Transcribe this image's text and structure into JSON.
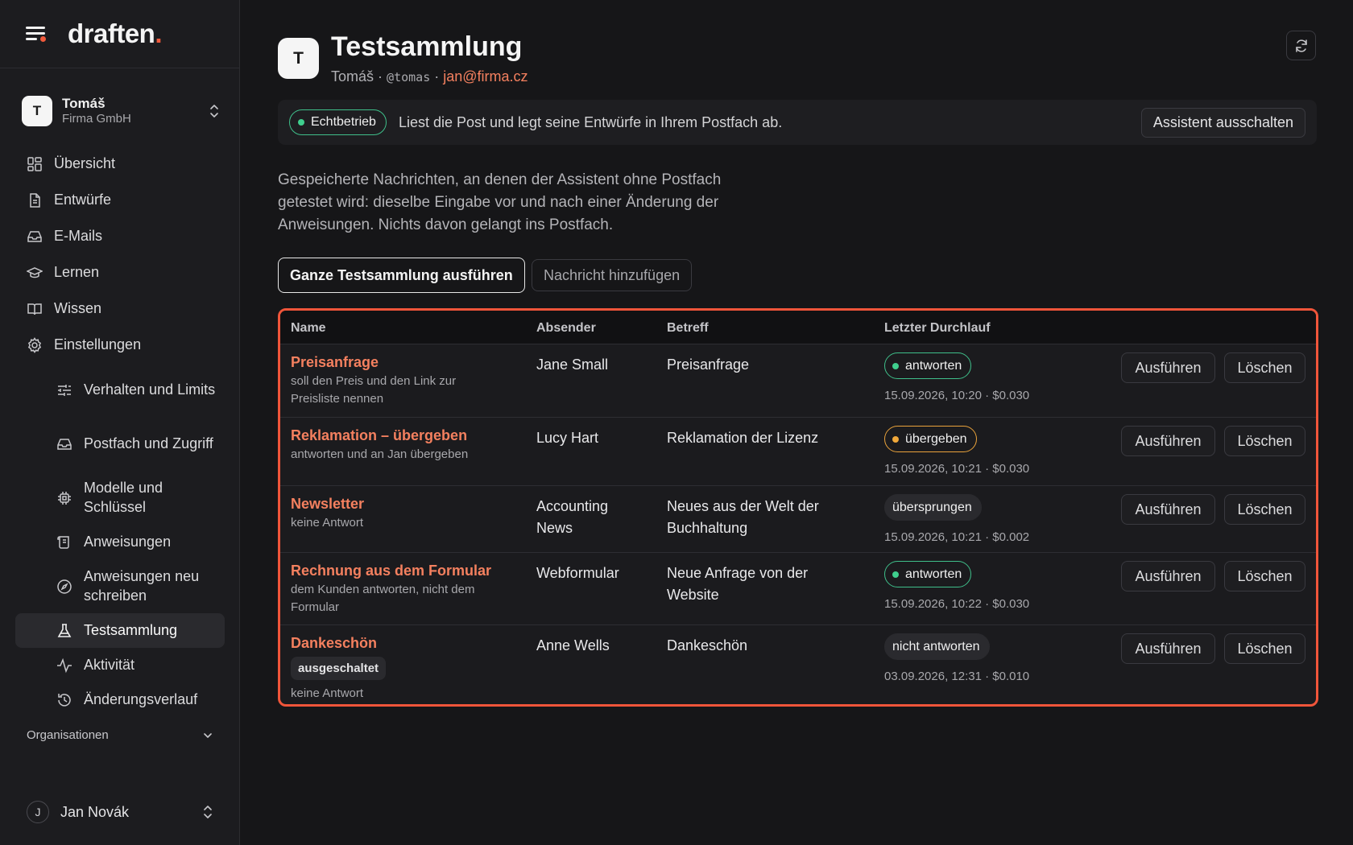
{
  "app": {
    "logo_text": "draften",
    "logo_dot": "."
  },
  "account": {
    "initial": "T",
    "name": "Tomáš",
    "org": "Firma GmbH"
  },
  "nav": {
    "overview": "Übersicht",
    "drafts": "Entwürfe",
    "emails": "E-Mails",
    "learn": "Lernen",
    "knowledge": "Wissen",
    "settings": "Einstellungen",
    "behavior": "Verhalten und Limits",
    "mailbox": "Postfach und Zugriff",
    "models": "Modelle und Schlüssel",
    "instructions": "Anweisungen",
    "rewrite": "Anweisungen neu schreiben",
    "testsuite": "Testsammlung",
    "activity": "Aktivität",
    "history": "Änderungsverlauf"
  },
  "organizations_label": "Organisationen",
  "user": {
    "initial": "J",
    "name": "Jan Novák"
  },
  "header": {
    "initial": "T",
    "title": "Testsammlung",
    "name": "Tomáš",
    "separator": "·",
    "handle": "@tomas",
    "email": "jan@firma.cz"
  },
  "banner": {
    "status": "Echtbetrieb",
    "text": "Liest die Post und legt seine Entwürfe in Ihrem Postfach ab.",
    "button": "Assistent ausschalten"
  },
  "description": "Gespeicherte Nachrichten, an denen der Assistent ohne Postfach getestet wird: dieselbe Eingabe vor und nach einer Änderung der Anweisungen. Nichts davon gelangt ins Postfach.",
  "actions": {
    "run_all": "Ganze Testsammlung ausführen",
    "add": "Nachricht hinzufügen"
  },
  "table": {
    "columns": {
      "name": "Name",
      "sender": "Absender",
      "subject": "Betreff",
      "last_run": "Letzter Durchlauf"
    },
    "run_label": "Ausführen",
    "delete_label": "Löschen",
    "rows": [
      {
        "name": "Preisanfrage",
        "note": "soll den Preis und den Link zur Preisliste nennen",
        "tag": "",
        "sender": "Jane Small",
        "subject": "Preisanfrage",
        "result": "antworten",
        "result_style": "green",
        "meta": "15.09.2026, 10:20 · $0.030"
      },
      {
        "name": "Reklamation – übergeben",
        "note": "antworten und an Jan übergeben",
        "tag": "",
        "sender": "Lucy Hart",
        "subject": "Reklamation der Lizenz",
        "result": "übergeben",
        "result_style": "orange",
        "meta": "15.09.2026, 10:21 · $0.030"
      },
      {
        "name": "Newsletter",
        "note": "keine Antwort",
        "tag": "",
        "sender": "Accounting News",
        "subject": "Neues aus der Welt der Buchhaltung",
        "result": "übersprungen",
        "result_style": "gray",
        "meta": "15.09.2026, 10:21 · $0.002"
      },
      {
        "name": "Rechnung aus dem Formular",
        "note": "dem Kunden antworten, nicht dem Formular",
        "tag": "",
        "sender": "Webformular",
        "subject": "Neue Anfrage von der Website",
        "result": "antworten",
        "result_style": "green",
        "meta": "15.09.2026, 10:22 · $0.030"
      },
      {
        "name": "Dankeschön",
        "note": "keine Antwort",
        "tag": "ausgeschaltet",
        "sender": "Anne Wells",
        "subject": "Dankeschön",
        "result": "nicht antworten",
        "result_style": "gray",
        "meta": "03.09.2026, 12:31 · $0.010"
      }
    ]
  },
  "colors": {
    "accent": "#f05a3c",
    "link": "#f4805f",
    "green": "#3fbf8a",
    "orange": "#e9a23b",
    "background": "#161618"
  }
}
